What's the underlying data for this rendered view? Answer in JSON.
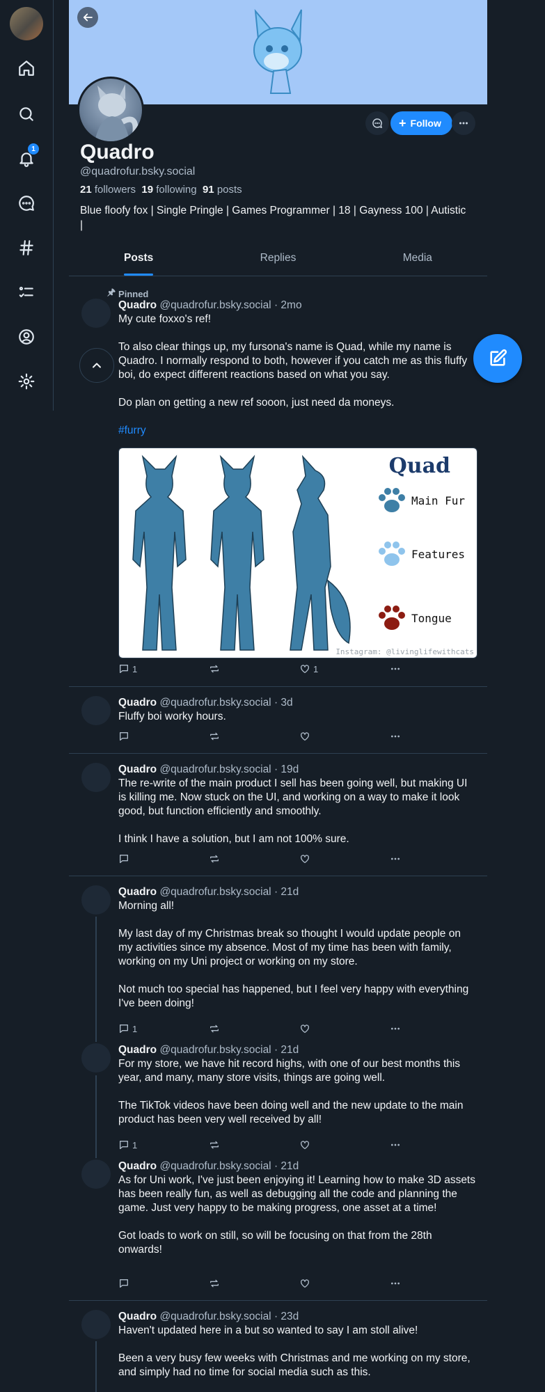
{
  "profile": {
    "display_name": "Quadro",
    "handle": "@quadrofur.bsky.social",
    "followers_count": "21",
    "followers_label": "followers",
    "following_count": "19",
    "following_label": "following",
    "posts_count": "91",
    "posts_label": "posts",
    "bio": "Blue floofy fox | Single Pringle | Games Programmer | 18 | Gayness 100 | Autistic\n|",
    "follow_label": "Follow"
  },
  "nav": {
    "notifications_badge": "1",
    "icons": [
      "home-icon",
      "search-icon",
      "bell-icon",
      "chat-icon",
      "hashtag-icon",
      "list-icon",
      "profile-icon",
      "settings-icon"
    ]
  },
  "tabs": [
    {
      "label": "Posts",
      "active": true
    },
    {
      "label": "Replies",
      "active": false
    },
    {
      "label": "Media",
      "active": false
    }
  ],
  "pinned_label": "Pinned",
  "posts": [
    {
      "author": "Quadro",
      "handle": "@quadrofur.bsky.social",
      "time": "2mo",
      "text": "My cute foxxo's ref!\n\nTo also clear things up, my fursona's name is Quad, while my name is Quadro. I normally respond to both, however if you catch me as this fluffy boi, do expect different reactions based on what you say.\n\nDo plan on getting a new ref sooon, just need da moneys.",
      "tag": "#furry",
      "replies": "1",
      "likes": "1"
    },
    {
      "author": "Quadro",
      "handle": "@quadrofur.bsky.social",
      "time": "3d",
      "text": "Fluffy boi worky hours.",
      "replies": "",
      "likes": ""
    },
    {
      "author": "Quadro",
      "handle": "@quadrofur.bsky.social",
      "time": "19d",
      "text": "The re-write of the main product I sell has been going well, but making UI is killing me. Now stuck on the UI, and working on a way to make it look good, but function efficiently and smoothly.\n\nI think I have a solution, but I am not 100% sure.",
      "replies": "",
      "likes": ""
    },
    {
      "author": "Quadro",
      "handle": "@quadrofur.bsky.social",
      "time": "21d",
      "text": "Morning all!\n\nMy last day of my Christmas break so thought I would update people on my activities since my absence. Most of my time has been with family, working on my Uni project or working on my store.\n\nNot much too special has happened, but I feel very happy with everything I've been doing!",
      "replies": "1",
      "likes": ""
    },
    {
      "author": "Quadro",
      "handle": "@quadrofur.bsky.social",
      "time": "21d",
      "text": "For my store, we have hit record highs, with one of our best months this year, and many, many store visits, things are going well.\n\nThe TikTok videos have been doing well and the new update to the main product has been very well received by all!",
      "replies": "1",
      "likes": ""
    },
    {
      "author": "Quadro",
      "handle": "@quadrofur.bsky.social",
      "time": "21d",
      "text": "As for Uni work, I've just been enjoying it! Learning how to make 3D assets has been really fun, as well as debugging all the code and planning the game. Just very happy to be making progress, one asset at a time!\n\nGot loads to work on still, so will be focusing on that from the 28th onwards!",
      "replies": "",
      "likes": ""
    },
    {
      "author": "Quadro",
      "handle": "@quadrofur.bsky.social",
      "time": "23d",
      "text": "Haven't updated here in a but so wanted to say I am stoll alive!\n\nBeen a very busy few weeks with Christmas and me working on my store, and simply had no time for social media such as this.",
      "replies": "",
      "likes": ""
    }
  ],
  "ref_sheet": {
    "title": "Quad",
    "legend": [
      "Main Fur",
      "Features",
      "Tongue"
    ],
    "legend_colors": [
      "#3e7fa6",
      "#8fc4ec",
      "#8c1c12"
    ],
    "watermark": "Instagram: @livinglifewithcats"
  },
  "colors": {
    "background": "#161e27",
    "accent": "#208bfe",
    "banner": "#a4c8f8",
    "border": "#2e4052",
    "muted_text": "#aebbc9"
  }
}
